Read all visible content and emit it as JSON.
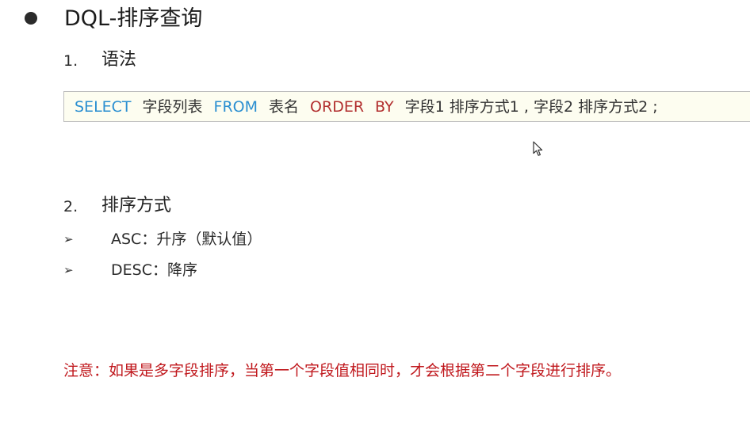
{
  "heading": {
    "title": "DQL-排序查询"
  },
  "section1": {
    "number": "1.",
    "label": "语法"
  },
  "syntax": {
    "select_kw": "SELECT",
    "field_list": "字段列表",
    "from_kw": "FROM",
    "table_name": "表名",
    "order_kw": "ORDER",
    "by_kw": "BY",
    "rest": "字段1  排序方式1 , 字段2  排序方式2 ;"
  },
  "section2": {
    "number": "2.",
    "label": "排序方式",
    "items": [
      {
        "text": "ASC：升序（默认值）"
      },
      {
        "text": "DESC：降序"
      }
    ]
  },
  "note": {
    "text": "注意：如果是多字段排序，当第一个字段值相同时，才会根据第二个字段进行排序。"
  },
  "icons": {
    "bullet": "bullet-dot-icon",
    "list_arrow": "arrowhead-icon",
    "cursor": "mouse-pointer-icon"
  },
  "colors": {
    "keyword_blue": "#2b8fd1",
    "keyword_red": "#b22f2f",
    "note_red": "#c0181d",
    "code_background": "#fdfdf0"
  }
}
